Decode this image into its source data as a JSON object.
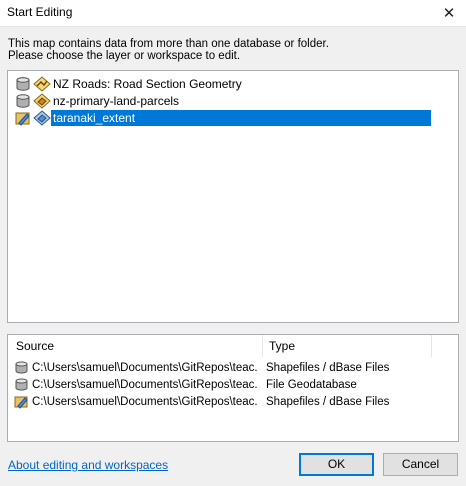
{
  "window": {
    "title": "Start Editing",
    "close_glyph": "✕"
  },
  "instructions": {
    "line1": "This map contains data from more than one database or folder.",
    "line2": "Please choose the layer or workspace to edit."
  },
  "layers": [
    {
      "label": "NZ Roads: Road Section Geometry",
      "workspace_icon": "database-icon",
      "layer_icon": "line-layer-icon",
      "selected": false
    },
    {
      "label": "nz-primary-land-parcels",
      "workspace_icon": "database-icon",
      "layer_icon": "polygon-layer-icon",
      "selected": false
    },
    {
      "label": "taranaki_extent",
      "workspace_icon": "folder-edit-icon",
      "layer_icon": "polygon-layer-icon",
      "selected": true
    }
  ],
  "sources": {
    "headers": {
      "source": "Source",
      "type": "Type"
    },
    "rows": [
      {
        "path": "C:\\Users\\samuel\\Documents\\GitRepos\\teac...",
        "type": "Shapefiles / dBase Files",
        "icon": "database-icon"
      },
      {
        "path": "C:\\Users\\samuel\\Documents\\GitRepos\\teac...",
        "type": "File Geodatabase",
        "icon": "database-icon"
      },
      {
        "path": "C:\\Users\\samuel\\Documents\\GitRepos\\teac...",
        "type": "Shapefiles / dBase Files",
        "icon": "folder-edit-icon"
      }
    ]
  },
  "footer": {
    "help_link": "About editing and workspaces",
    "ok_label": "OK",
    "cancel_label": "Cancel"
  },
  "colors": {
    "selection": "#0078d7",
    "link": "#0066cc"
  }
}
